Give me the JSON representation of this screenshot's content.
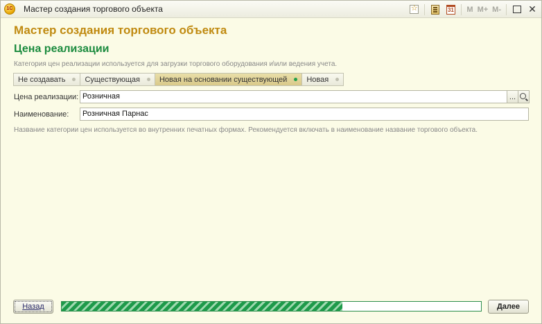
{
  "window": {
    "title": "Мастер создания торгового объекта",
    "app_icon_text": "1С",
    "toolbar": {
      "icons": [
        "favorite-icon",
        "calculator-icon",
        "calendar-icon"
      ],
      "calendar_day": "31",
      "memory_buttons": [
        "M",
        "M+",
        "M-"
      ]
    }
  },
  "form": {
    "header": "Мастер создания торгового объекта",
    "section_title": "Цена реализации",
    "description": "Категория цен реализации используется для загрузки торгового оборудования и\\или ведения учета.",
    "switcher": {
      "items": [
        {
          "label": "Не создавать",
          "active": false
        },
        {
          "label": "Существующая",
          "active": false
        },
        {
          "label": "Новая на основании существующей",
          "active": true
        },
        {
          "label": "Новая",
          "active": false
        }
      ]
    },
    "price_field": {
      "label": "Цена реализации:",
      "value": "Розничная",
      "select_button": "..."
    },
    "name_field": {
      "label": "Наименование:",
      "value": "Розничная Парнас"
    },
    "hint": "Название категории цен  используется во внутренних печатных формах. Рекомендуется включать в наименование название торгового объекта."
  },
  "footer": {
    "back_label": "Назад",
    "next_label": "Далее",
    "progress": 0.67
  }
}
